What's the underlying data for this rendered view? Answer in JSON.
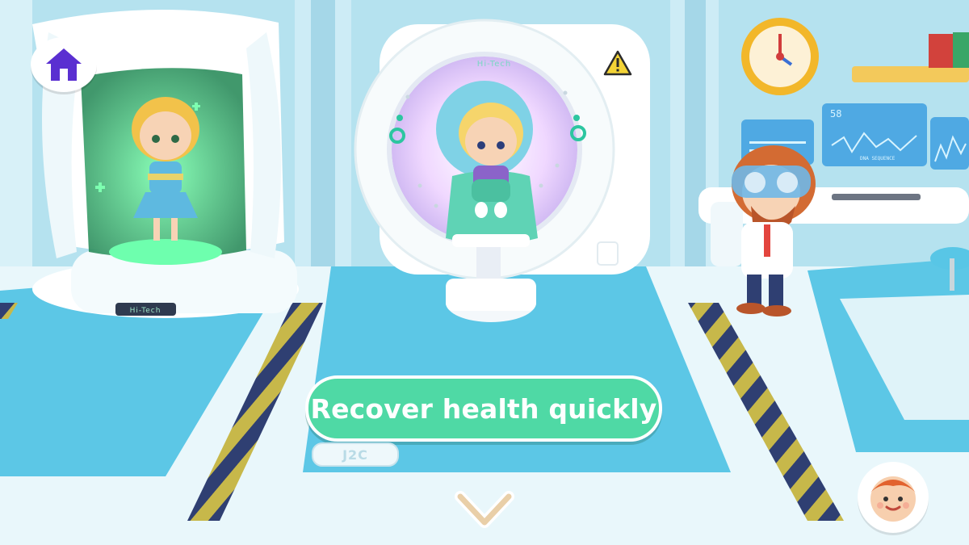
{
  "hud": {
    "home_icon": "home-icon",
    "caption": "Recover health quickly",
    "floor_tag": "J2C",
    "next_icon": "chevron-down-icon",
    "avatar_icon": "boy-face-icon"
  },
  "scanner": {
    "brand_label": "Hi-Tech",
    "warning_icon": "warning-triangle-icon"
  },
  "pod": {
    "brand_label": "Hi-Tech"
  },
  "monitor": {
    "heart_rate": "58",
    "caption": "DNA SEQUENCE"
  },
  "colors": {
    "floor": "#5cc7e6",
    "caption_bg": "#4fd9a5",
    "home_icon": "#5a2fd1",
    "hazard_yellow": "#c7b84a",
    "hazard_navy": "#2f3f72"
  }
}
